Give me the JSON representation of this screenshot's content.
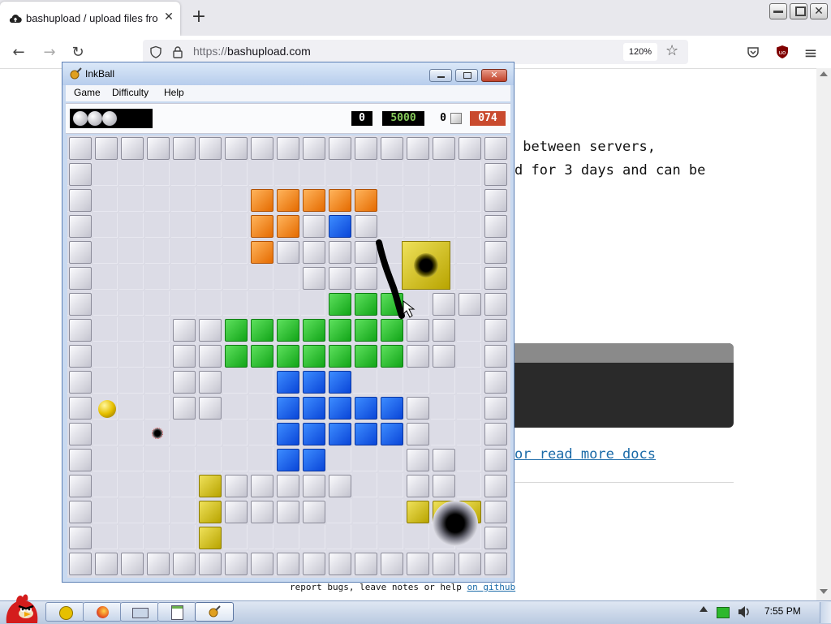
{
  "browser": {
    "tab_title": "bashupload / upload files fro",
    "close_glyph": "✕",
    "new_tab_glyph": "+",
    "url_protocol": "https://",
    "url_host": "bashupload.com",
    "zoom": "120%",
    "nav_glyphs": {
      "back": "←",
      "forward": "→",
      "reload": "↻",
      "menu": "≡",
      "bookmark": "☆"
    }
  },
  "page": {
    "line1": " between servers,",
    "line2": "d for 3 days and can be",
    "link": "or read more docs",
    "footer_prefix": "report bugs, leave notes or help ",
    "footer_link": "on github"
  },
  "inkball": {
    "title": "InkBall",
    "menu": [
      "Game",
      "Difficulty",
      "Help"
    ],
    "counters": {
      "c1": "0",
      "score": "5000",
      "c3": "0",
      "timer": "074"
    },
    "colors": {
      "counter_bg": "#000000",
      "score_text": "#86c95a",
      "timer_bg": "#c94a2e"
    }
  },
  "taskbar": {
    "clock": "7:55 PM"
  }
}
